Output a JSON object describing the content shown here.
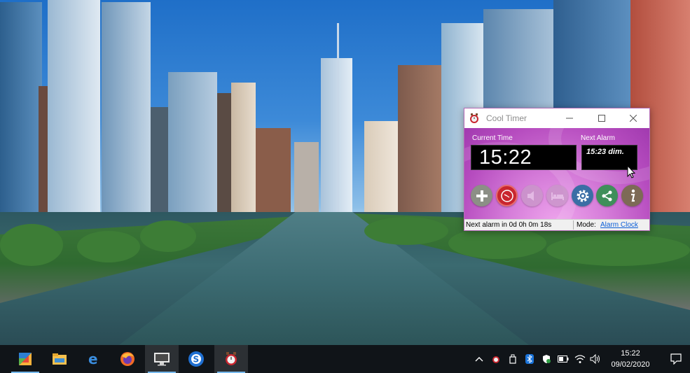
{
  "window": {
    "title": "Cool Timer",
    "current_time_label": "Current Time",
    "current_time": "15:22",
    "next_alarm_label": "Next Alarm",
    "next_alarm": "15:23 dim.",
    "toolbar": [
      {
        "name": "add-icon"
      },
      {
        "name": "alarm-clock-icon"
      },
      {
        "name": "sound-icon"
      },
      {
        "name": "snooze-bed-icon"
      },
      {
        "name": "gear-icon"
      },
      {
        "name": "share-icon"
      },
      {
        "name": "info-icon"
      }
    ],
    "status": {
      "next_text": "Next alarm in 0d 0h 0m 18s",
      "mode_label": "Mode:",
      "mode_value": "Alarm Clock"
    }
  },
  "taskbar": {
    "apps": [
      {
        "name": "start-icon"
      },
      {
        "name": "file-explorer-icon"
      },
      {
        "name": "edge-icon"
      },
      {
        "name": "firefox-icon"
      },
      {
        "name": "desktop-app-icon"
      },
      {
        "name": "sync-app-icon"
      },
      {
        "name": "cool-timer-taskbar-icon"
      }
    ],
    "clock_time": "15:22",
    "clock_date": "09/02/2020"
  },
  "colors": {
    "client_purple": "#b64cbf",
    "alarm_red": "#c9262f",
    "link_blue": "#0b5fd7",
    "taskbar": "#101418"
  }
}
